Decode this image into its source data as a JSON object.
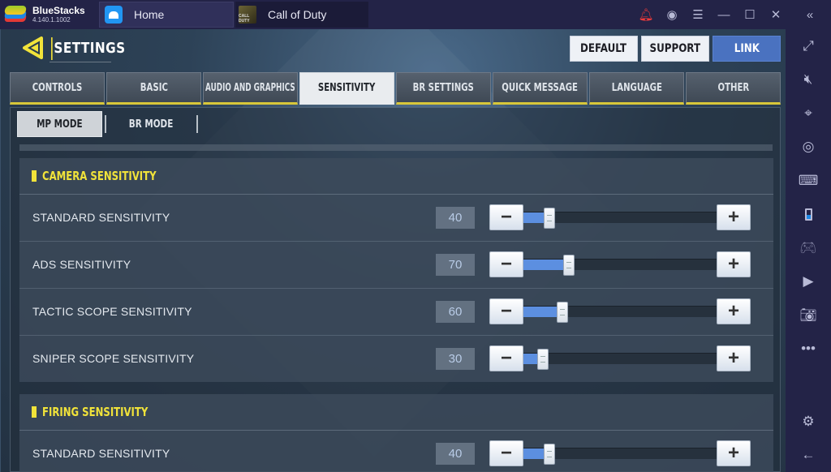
{
  "app": {
    "name": "BlueStacks",
    "version": "4.140.1.1002",
    "tabs": [
      {
        "label": "Home",
        "icon": "home-icon"
      },
      {
        "label": "Call of Duty",
        "icon": "call-of-duty-icon",
        "icon_text": "CALL DUTY"
      }
    ],
    "title_icons": [
      "notification-bell-icon",
      "account-icon",
      "menu-icon",
      "minimize-icon",
      "maximize-icon",
      "close-icon",
      "collapse-sidebar-icon"
    ],
    "sidebar_icons": [
      "fullscreen-icon",
      "mute-icon",
      "pointer-lock-icon",
      "eye-icon",
      "keyboard-icon",
      "rotate-phone-icon",
      "gamepad-icon",
      "media-manager-icon",
      "camera-icon",
      "more-icon",
      "settings-gear-icon",
      "back-arrow-icon"
    ],
    "accent_color": "#2196f3"
  },
  "game": {
    "title": "SETTINGS",
    "top_buttons": {
      "default": "DEFAULT",
      "support": "SUPPORT",
      "link": "LINK"
    },
    "tabs": [
      {
        "label": "CONTROLS",
        "active": false
      },
      {
        "label": "BASIC",
        "active": false
      },
      {
        "label": "AUDIO AND GRAPHICS",
        "active": false
      },
      {
        "label": "SENSITIVITY",
        "active": true
      },
      {
        "label": "BR SETTINGS",
        "active": false
      },
      {
        "label": "QUICK MESSAGE",
        "active": false
      },
      {
        "label": "LANGUAGE",
        "active": false
      },
      {
        "label": "OTHER",
        "active": false
      }
    ],
    "modes": [
      {
        "label": "MP MODE",
        "active": true
      },
      {
        "label": "BR MODE",
        "active": false
      }
    ],
    "slider_range": [
      0,
      300
    ],
    "sections": [
      {
        "title": "CAMERA SENSITIVITY",
        "rows": [
          {
            "label": "STANDARD SENSITIVITY",
            "value": 40
          },
          {
            "label": "ADS SENSITIVITY",
            "value": 70
          },
          {
            "label": "TACTIC SCOPE SENSITIVITY",
            "value": 60
          },
          {
            "label": "SNIPER SCOPE SENSITIVITY",
            "value": 30
          }
        ]
      },
      {
        "title": "FIRING SENSITIVITY",
        "rows": [
          {
            "label": "STANDARD SENSITIVITY",
            "value": 40
          }
        ]
      }
    ],
    "highlight_color": "#f1e33a",
    "fill_color": "#5c8fe0"
  }
}
